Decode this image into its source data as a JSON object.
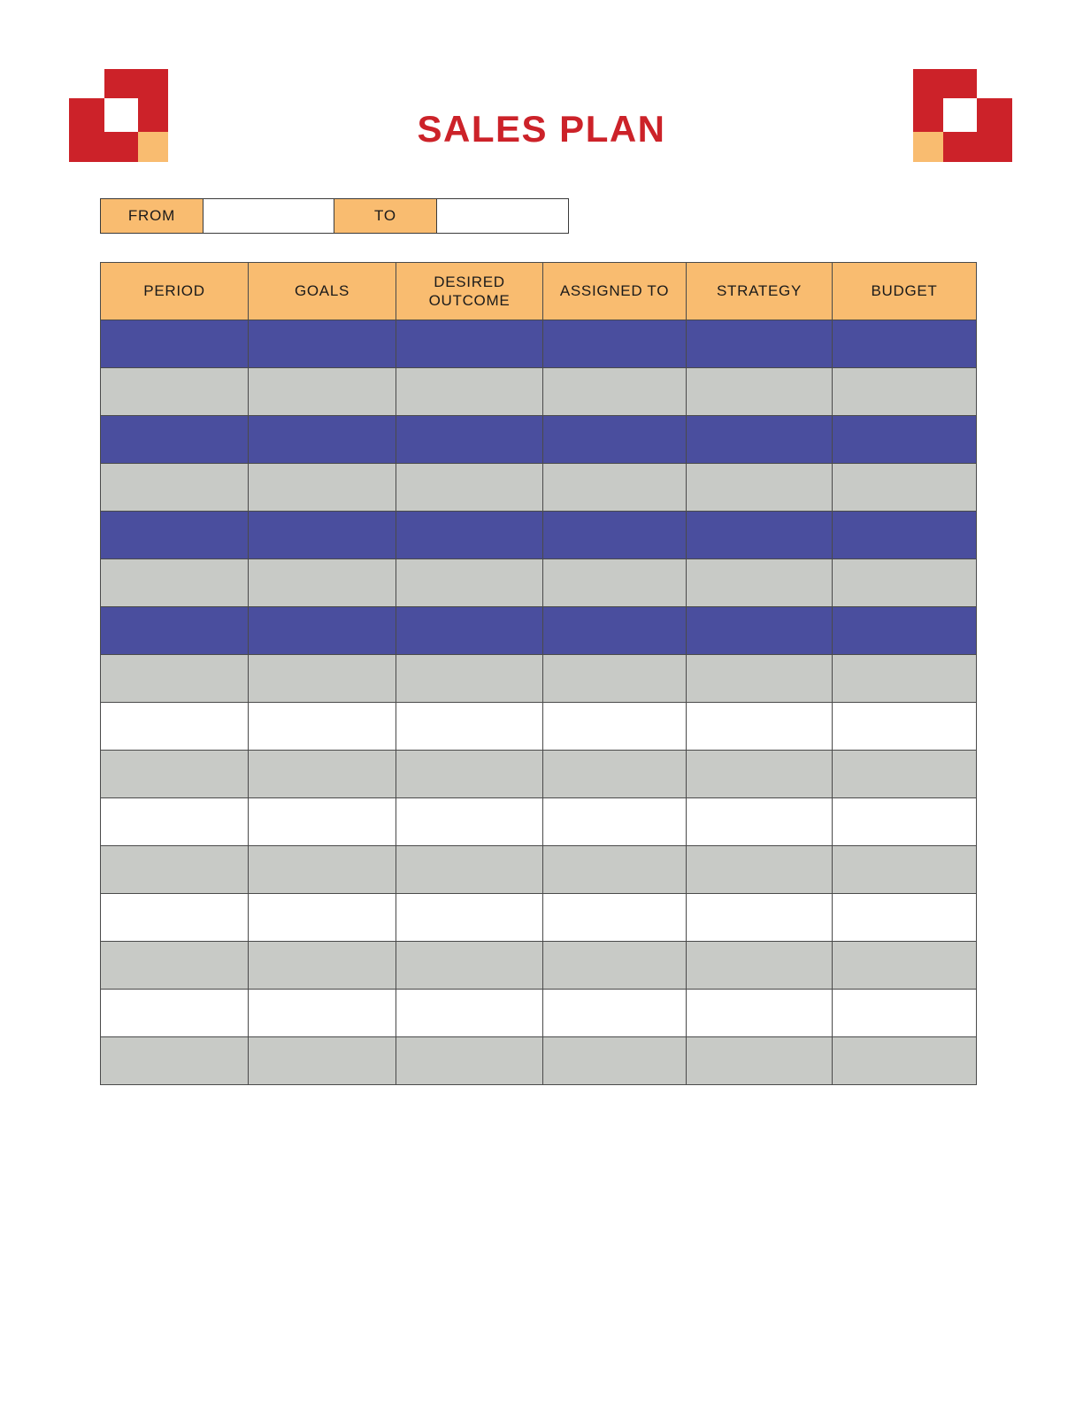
{
  "document": {
    "title": "SALES PLAN"
  },
  "theme": {
    "brand_red": "#CC2229",
    "accent_orange": "#F9BC70",
    "row_blue": "#4A4E9E",
    "row_gray": "#C8CAC6",
    "row_white": "#FFFFFF",
    "border": "#4A4A4A",
    "text": "#1A1A1A"
  },
  "logo": {
    "name": "brand-logo-squares",
    "colors": {
      "red": "#CC2229",
      "white": "#FFFFFF",
      "orange": "#F9BC70"
    }
  },
  "date_range": {
    "from_label": "FROM",
    "from_value": "",
    "from_placeholder": "",
    "to_label": "TO",
    "to_value": "",
    "to_placeholder": ""
  },
  "table": {
    "headers": [
      "PERIOD",
      "GOALS",
      "DESIRED\nOUTCOME",
      "ASSIGNED TO",
      "STRATEGY",
      "BUDGET"
    ],
    "row_count": 16,
    "column_count": 6,
    "row_styles": [
      "blue",
      "gray",
      "blue",
      "gray",
      "blue",
      "gray",
      "blue",
      "gray",
      "white",
      "gray",
      "white",
      "gray",
      "white",
      "gray",
      "white",
      "gray"
    ],
    "rows": [
      {
        "period": "",
        "goals": "",
        "desired_outcome": "",
        "assigned_to": "",
        "strategy": "",
        "budget": ""
      },
      {
        "period": "",
        "goals": "",
        "desired_outcome": "",
        "assigned_to": "",
        "strategy": "",
        "budget": ""
      },
      {
        "period": "",
        "goals": "",
        "desired_outcome": "",
        "assigned_to": "",
        "strategy": "",
        "budget": ""
      },
      {
        "period": "",
        "goals": "",
        "desired_outcome": "",
        "assigned_to": "",
        "strategy": "",
        "budget": ""
      },
      {
        "period": "",
        "goals": "",
        "desired_outcome": "",
        "assigned_to": "",
        "strategy": "",
        "budget": ""
      },
      {
        "period": "",
        "goals": "",
        "desired_outcome": "",
        "assigned_to": "",
        "strategy": "",
        "budget": ""
      },
      {
        "period": "",
        "goals": "",
        "desired_outcome": "",
        "assigned_to": "",
        "strategy": "",
        "budget": ""
      },
      {
        "period": "",
        "goals": "",
        "desired_outcome": "",
        "assigned_to": "",
        "strategy": "",
        "budget": ""
      },
      {
        "period": "",
        "goals": "",
        "desired_outcome": "",
        "assigned_to": "",
        "strategy": "",
        "budget": ""
      },
      {
        "period": "",
        "goals": "",
        "desired_outcome": "",
        "assigned_to": "",
        "strategy": "",
        "budget": ""
      },
      {
        "period": "",
        "goals": "",
        "desired_outcome": "",
        "assigned_to": "",
        "strategy": "",
        "budget": ""
      },
      {
        "period": "",
        "goals": "",
        "desired_outcome": "",
        "assigned_to": "",
        "strategy": "",
        "budget": ""
      },
      {
        "period": "",
        "goals": "",
        "desired_outcome": "",
        "assigned_to": "",
        "strategy": "",
        "budget": ""
      },
      {
        "period": "",
        "goals": "",
        "desired_outcome": "",
        "assigned_to": "",
        "strategy": "",
        "budget": ""
      },
      {
        "period": "",
        "goals": "",
        "desired_outcome": "",
        "assigned_to": "",
        "strategy": "",
        "budget": ""
      },
      {
        "period": "",
        "goals": "",
        "desired_outcome": "",
        "assigned_to": "",
        "strategy": "",
        "budget": ""
      }
    ]
  }
}
